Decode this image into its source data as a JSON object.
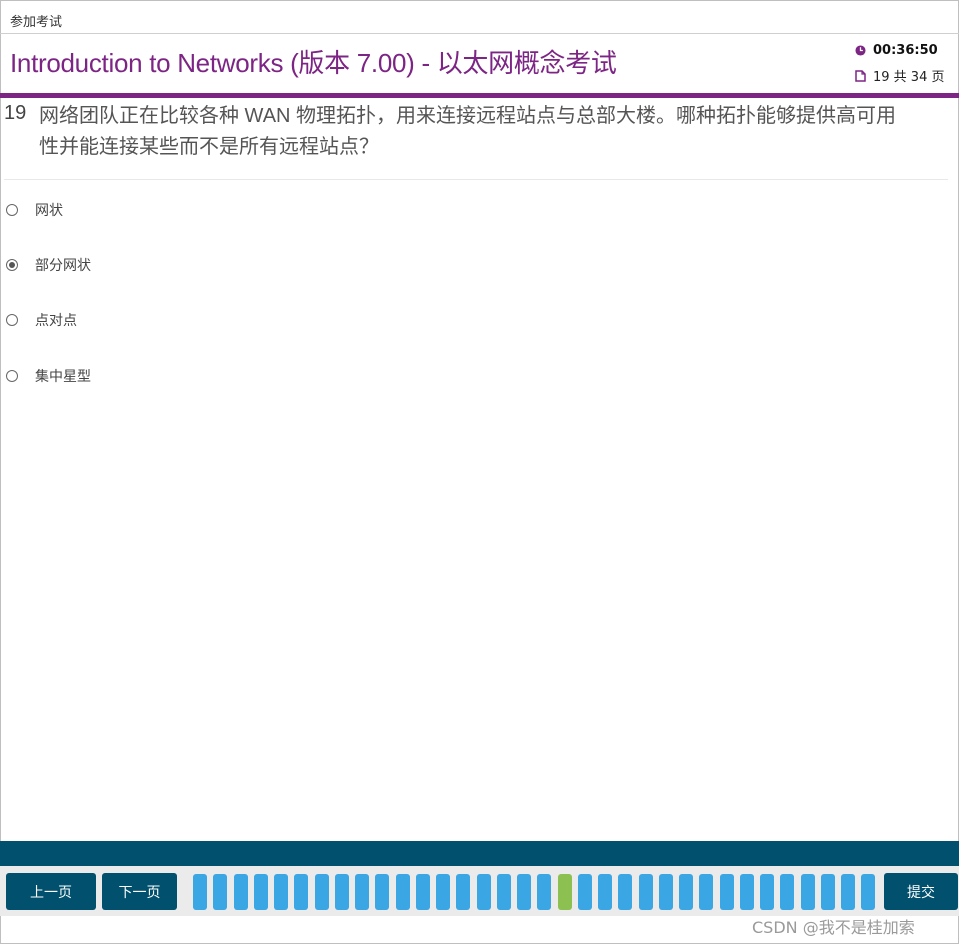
{
  "header": {
    "top_label": "参加考试",
    "exam_title": "Introduction to Networks (版本 7.00) - 以太网概念考试",
    "timer": "00:36:50",
    "page_indicator": "19 共 34 页"
  },
  "question": {
    "number": "19",
    "text": "网络团队正在比较各种 WAN 物理拓扑，用来连接远程站点与总部大楼。哪种拓扑能够提供高可用性并能连接某些而不是所有远程站点？",
    "options": [
      {
        "label": "网状",
        "selected": false
      },
      {
        "label": "部分网状",
        "selected": true
      },
      {
        "label": "点对点",
        "selected": false
      },
      {
        "label": "集中星型",
        "selected": false
      }
    ]
  },
  "footer": {
    "prev_label": "上一页",
    "next_label": "下一页",
    "submit_label": "提交",
    "question_count": 34,
    "current_question": 19
  },
  "colors": {
    "brand_purple": "#7d2585",
    "nav_blue": "#00506e",
    "tab_blue": "#3aa6e4",
    "tab_current_green": "#8cc152"
  },
  "icons": {
    "timer": "clock-icon",
    "page": "document-icon"
  },
  "watermark": "CSDN @我不是桂加索"
}
